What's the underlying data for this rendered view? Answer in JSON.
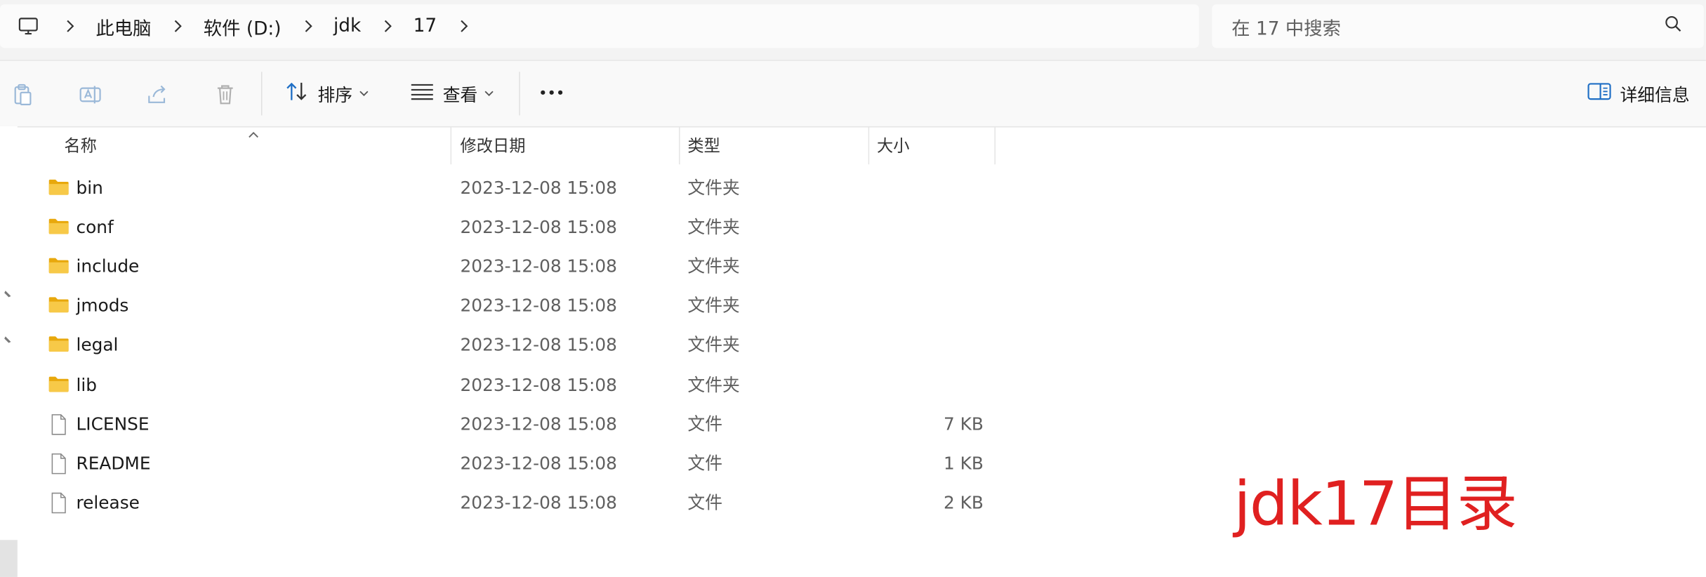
{
  "breadcrumb": {
    "items": [
      "此电脑",
      "软件 (D:)",
      "jdk",
      "17"
    ]
  },
  "search": {
    "placeholder": "在 17 中搜索"
  },
  "toolbar": {
    "sort_label": "排序",
    "view_label": "查看",
    "details_label": "详细信息"
  },
  "columns": {
    "name": "名称",
    "date": "修改日期",
    "type": "类型",
    "size": "大小"
  },
  "files": [
    {
      "name": "bin",
      "date": "2023-12-08 15:08",
      "type": "文件夹",
      "size": "",
      "kind": "folder"
    },
    {
      "name": "conf",
      "date": "2023-12-08 15:08",
      "type": "文件夹",
      "size": "",
      "kind": "folder"
    },
    {
      "name": "include",
      "date": "2023-12-08 15:08",
      "type": "文件夹",
      "size": "",
      "kind": "folder"
    },
    {
      "name": "jmods",
      "date": "2023-12-08 15:08",
      "type": "文件夹",
      "size": "",
      "kind": "folder"
    },
    {
      "name": "legal",
      "date": "2023-12-08 15:08",
      "type": "文件夹",
      "size": "",
      "kind": "folder"
    },
    {
      "name": "lib",
      "date": "2023-12-08 15:08",
      "type": "文件夹",
      "size": "",
      "kind": "folder"
    },
    {
      "name": "LICENSE",
      "date": "2023-12-08 15:08",
      "type": "文件",
      "size": "7 KB",
      "kind": "file"
    },
    {
      "name": "README",
      "date": "2023-12-08 15:08",
      "type": "文件",
      "size": "1 KB",
      "kind": "file"
    },
    {
      "name": "release",
      "date": "2023-12-08 15:08",
      "type": "文件",
      "size": "2 KB",
      "kind": "file"
    }
  ],
  "annotation": "jdk17目录",
  "colors": {
    "folder": "#f5c542",
    "annotation": "#e02020",
    "accent": "#0067c0"
  }
}
